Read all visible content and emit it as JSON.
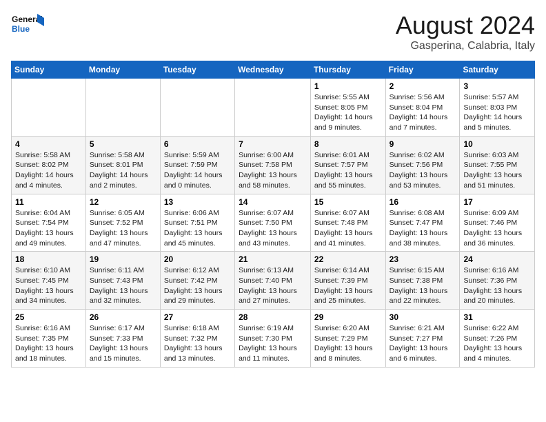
{
  "header": {
    "logo_line1": "General",
    "logo_line2": "Blue",
    "month_year": "August 2024",
    "location": "Gasperina, Calabria, Italy"
  },
  "weekdays": [
    "Sunday",
    "Monday",
    "Tuesday",
    "Wednesday",
    "Thursday",
    "Friday",
    "Saturday"
  ],
  "weeks": [
    [
      {
        "day": "",
        "info": ""
      },
      {
        "day": "",
        "info": ""
      },
      {
        "day": "",
        "info": ""
      },
      {
        "day": "",
        "info": ""
      },
      {
        "day": "1",
        "info": "Sunrise: 5:55 AM\nSunset: 8:05 PM\nDaylight: 14 hours\nand 9 minutes."
      },
      {
        "day": "2",
        "info": "Sunrise: 5:56 AM\nSunset: 8:04 PM\nDaylight: 14 hours\nand 7 minutes."
      },
      {
        "day": "3",
        "info": "Sunrise: 5:57 AM\nSunset: 8:03 PM\nDaylight: 14 hours\nand 5 minutes."
      }
    ],
    [
      {
        "day": "4",
        "info": "Sunrise: 5:58 AM\nSunset: 8:02 PM\nDaylight: 14 hours\nand 4 minutes."
      },
      {
        "day": "5",
        "info": "Sunrise: 5:58 AM\nSunset: 8:01 PM\nDaylight: 14 hours\nand 2 minutes."
      },
      {
        "day": "6",
        "info": "Sunrise: 5:59 AM\nSunset: 7:59 PM\nDaylight: 14 hours\nand 0 minutes."
      },
      {
        "day": "7",
        "info": "Sunrise: 6:00 AM\nSunset: 7:58 PM\nDaylight: 13 hours\nand 58 minutes."
      },
      {
        "day": "8",
        "info": "Sunrise: 6:01 AM\nSunset: 7:57 PM\nDaylight: 13 hours\nand 55 minutes."
      },
      {
        "day": "9",
        "info": "Sunrise: 6:02 AM\nSunset: 7:56 PM\nDaylight: 13 hours\nand 53 minutes."
      },
      {
        "day": "10",
        "info": "Sunrise: 6:03 AM\nSunset: 7:55 PM\nDaylight: 13 hours\nand 51 minutes."
      }
    ],
    [
      {
        "day": "11",
        "info": "Sunrise: 6:04 AM\nSunset: 7:54 PM\nDaylight: 13 hours\nand 49 minutes."
      },
      {
        "day": "12",
        "info": "Sunrise: 6:05 AM\nSunset: 7:52 PM\nDaylight: 13 hours\nand 47 minutes."
      },
      {
        "day": "13",
        "info": "Sunrise: 6:06 AM\nSunset: 7:51 PM\nDaylight: 13 hours\nand 45 minutes."
      },
      {
        "day": "14",
        "info": "Sunrise: 6:07 AM\nSunset: 7:50 PM\nDaylight: 13 hours\nand 43 minutes."
      },
      {
        "day": "15",
        "info": "Sunrise: 6:07 AM\nSunset: 7:48 PM\nDaylight: 13 hours\nand 41 minutes."
      },
      {
        "day": "16",
        "info": "Sunrise: 6:08 AM\nSunset: 7:47 PM\nDaylight: 13 hours\nand 38 minutes."
      },
      {
        "day": "17",
        "info": "Sunrise: 6:09 AM\nSunset: 7:46 PM\nDaylight: 13 hours\nand 36 minutes."
      }
    ],
    [
      {
        "day": "18",
        "info": "Sunrise: 6:10 AM\nSunset: 7:45 PM\nDaylight: 13 hours\nand 34 minutes."
      },
      {
        "day": "19",
        "info": "Sunrise: 6:11 AM\nSunset: 7:43 PM\nDaylight: 13 hours\nand 32 minutes."
      },
      {
        "day": "20",
        "info": "Sunrise: 6:12 AM\nSunset: 7:42 PM\nDaylight: 13 hours\nand 29 minutes."
      },
      {
        "day": "21",
        "info": "Sunrise: 6:13 AM\nSunset: 7:40 PM\nDaylight: 13 hours\nand 27 minutes."
      },
      {
        "day": "22",
        "info": "Sunrise: 6:14 AM\nSunset: 7:39 PM\nDaylight: 13 hours\nand 25 minutes."
      },
      {
        "day": "23",
        "info": "Sunrise: 6:15 AM\nSunset: 7:38 PM\nDaylight: 13 hours\nand 22 minutes."
      },
      {
        "day": "24",
        "info": "Sunrise: 6:16 AM\nSunset: 7:36 PM\nDaylight: 13 hours\nand 20 minutes."
      }
    ],
    [
      {
        "day": "25",
        "info": "Sunrise: 6:16 AM\nSunset: 7:35 PM\nDaylight: 13 hours\nand 18 minutes."
      },
      {
        "day": "26",
        "info": "Sunrise: 6:17 AM\nSunset: 7:33 PM\nDaylight: 13 hours\nand 15 minutes."
      },
      {
        "day": "27",
        "info": "Sunrise: 6:18 AM\nSunset: 7:32 PM\nDaylight: 13 hours\nand 13 minutes."
      },
      {
        "day": "28",
        "info": "Sunrise: 6:19 AM\nSunset: 7:30 PM\nDaylight: 13 hours\nand 11 minutes."
      },
      {
        "day": "29",
        "info": "Sunrise: 6:20 AM\nSunset: 7:29 PM\nDaylight: 13 hours\nand 8 minutes."
      },
      {
        "day": "30",
        "info": "Sunrise: 6:21 AM\nSunset: 7:27 PM\nDaylight: 13 hours\nand 6 minutes."
      },
      {
        "day": "31",
        "info": "Sunrise: 6:22 AM\nSunset: 7:26 PM\nDaylight: 13 hours\nand 4 minutes."
      }
    ]
  ]
}
